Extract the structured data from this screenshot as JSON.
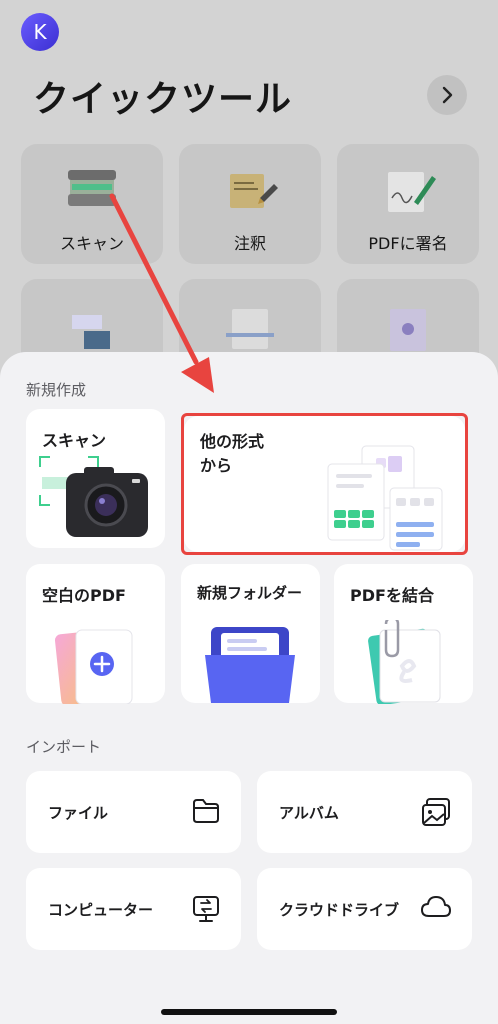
{
  "avatar": {
    "initial": "K"
  },
  "quick_tools": {
    "title": "クイックツール",
    "items": [
      {
        "label": "スキャン",
        "icon": "scanner-icon"
      },
      {
        "label": "注釈",
        "icon": "notes-icon"
      },
      {
        "label": "PDFに署名",
        "icon": "signature-icon"
      },
      {
        "label": "",
        "icon": "text-image-icon"
      },
      {
        "label": "",
        "icon": "ocr-icon"
      },
      {
        "label": "",
        "icon": "image-to-pdf-icon"
      }
    ]
  },
  "create_section": {
    "label": "新規作成",
    "scan": "スキャン",
    "other_format": "他の形式\nから",
    "blank_pdf": "空白のPDF",
    "new_folder": "新規フォルダー",
    "merge_pdf": "PDFを結合"
  },
  "import_section": {
    "label": "インポート",
    "file": "ファイル",
    "album": "アルバム",
    "computer": "コンピューター",
    "cloud_drive": "クラウドドライブ"
  },
  "colors": {
    "highlight": "#e8443f",
    "accent": "#5865f2",
    "arrow": "#e8443f"
  }
}
